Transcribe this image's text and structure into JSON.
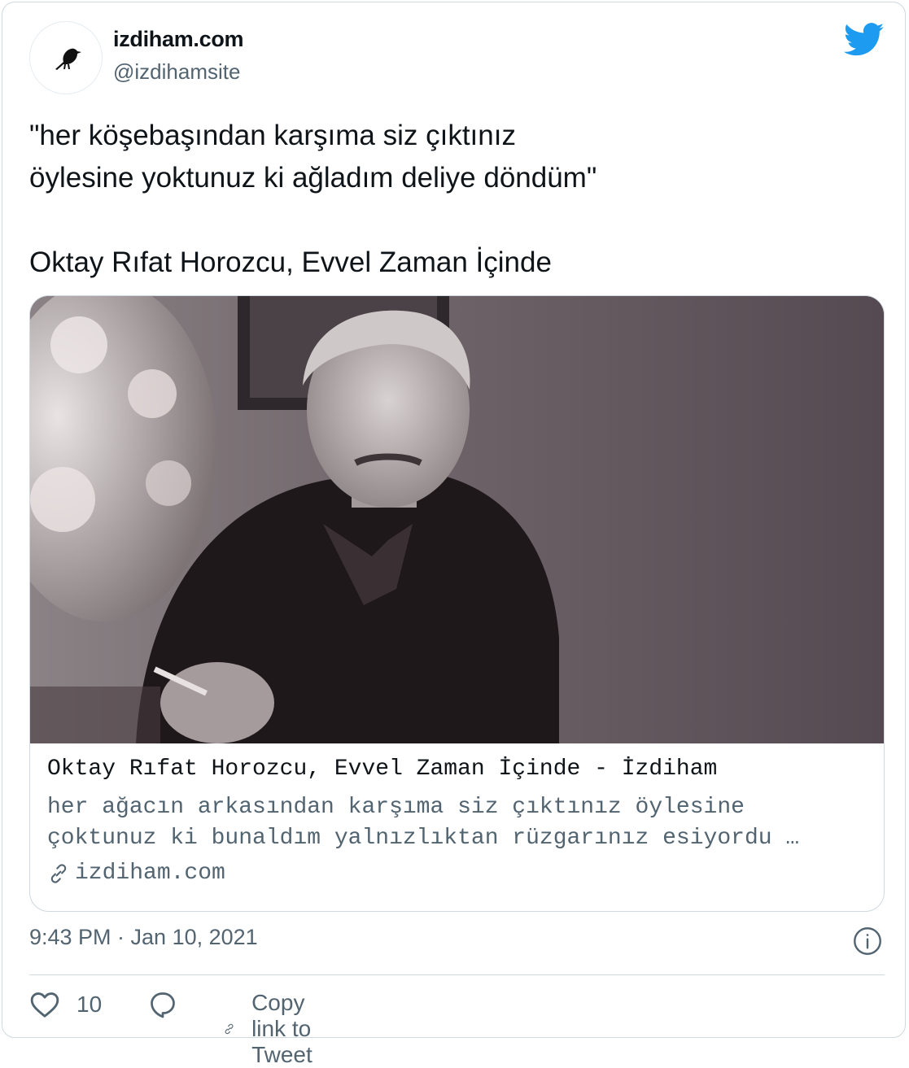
{
  "tweet": {
    "display_name": "izdiham.com",
    "handle": "@izdihamsite",
    "text": "\"her köşebaşından karşıma siz çıktınız\nöylesine yoktunuz ki ağladım deliye döndüm\"\n\nOktay Rıfat Horozcu, Evvel Zaman İçinde",
    "timestamp": "9:43 PM · Jan 10, 2021"
  },
  "link_card": {
    "title": "Oktay Rıfat Horozcu, Evvel Zaman İçinde - İzdiham",
    "description": "her ağacın arkasından karşıma siz çıktınız öylesine\nçoktunuz ki bunaldım yalnızlıktan rüzgarınız esiyordu …",
    "domain": "izdiham.com"
  },
  "actions": {
    "like_count": "10",
    "copy_link_label": "Copy link to Tweet"
  },
  "icons": {
    "brand": "twitter-bird-icon",
    "avatar": "crow-icon",
    "like": "heart-icon",
    "reply": "reply-bubble-icon",
    "copy": "link-icon",
    "info": "info-icon"
  },
  "colors": {
    "twitter_blue": "#1d9bf0",
    "secondary_text": "#536471",
    "border": "#cfd9de"
  }
}
